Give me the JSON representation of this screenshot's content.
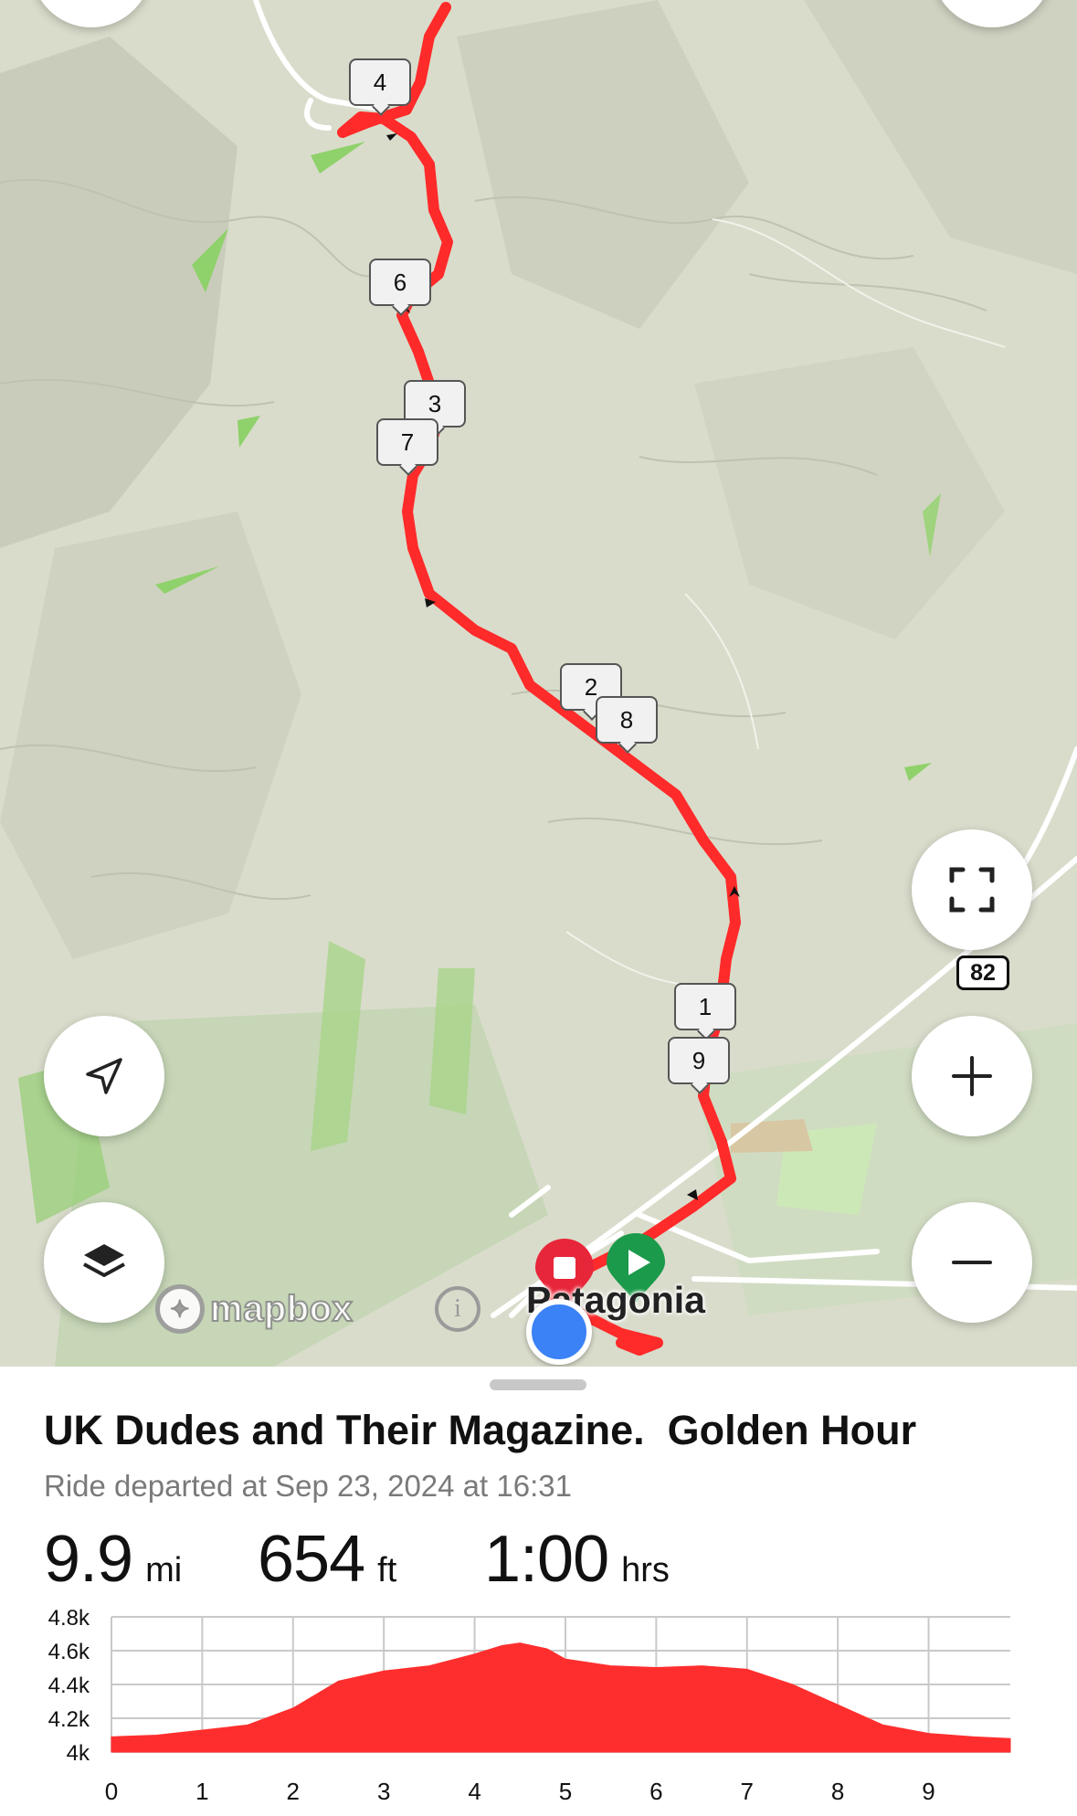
{
  "map": {
    "town_label": "Patagonia",
    "highway_shield": "82",
    "attribution": "mapbox",
    "accent_route_color": "#ff2a2a",
    "km_markers": [
      "4",
      "6",
      "3",
      "7",
      "2",
      "8",
      "1",
      "9"
    ],
    "controls": {
      "left": [
        "navigate-arrow-icon",
        "layers-icon"
      ],
      "right": [
        "fullscreen-icon",
        "zoom-in-icon",
        "zoom-out-icon"
      ]
    },
    "start_marker_color": "#1a9a4a",
    "end_marker_color": "#e8263a",
    "current_location_color": "#3b82f6"
  },
  "ride": {
    "title": "UK Dudes and Their Magazine.  Golden Hour",
    "subtitle": "Ride departed at Sep 23, 2024 at 16:31",
    "stats": [
      {
        "value": "9.9",
        "unit": "mi"
      },
      {
        "value": "654",
        "unit": "ft"
      },
      {
        "value": "1:00",
        "unit": "hrs"
      }
    ]
  },
  "chart_data": {
    "type": "area",
    "title": "",
    "xlabel": "",
    "ylabel": "",
    "x_ticks": [
      "0",
      "1",
      "2",
      "3",
      "4",
      "5",
      "6",
      "7",
      "8",
      "9"
    ],
    "y_ticks": [
      "4.8k",
      "4.6k",
      "4.4k",
      "4.2k",
      "4k"
    ],
    "xlim": [
      0,
      9.9
    ],
    "ylim": [
      4000,
      4800
    ],
    "grid": true,
    "color": "#ff2e2e",
    "x": [
      0,
      0.5,
      1,
      1.5,
      2,
      2.5,
      3,
      3.5,
      4,
      4.3,
      4.5,
      4.8,
      5,
      5.5,
      6,
      6.5,
      7,
      7.5,
      8,
      8.5,
      9,
      9.5,
      9.9
    ],
    "y": [
      4090,
      4100,
      4130,
      4160,
      4260,
      4420,
      4480,
      4510,
      4580,
      4630,
      4645,
      4610,
      4550,
      4510,
      4500,
      4510,
      4490,
      4400,
      4280,
      4160,
      4110,
      4090,
      4080
    ]
  }
}
